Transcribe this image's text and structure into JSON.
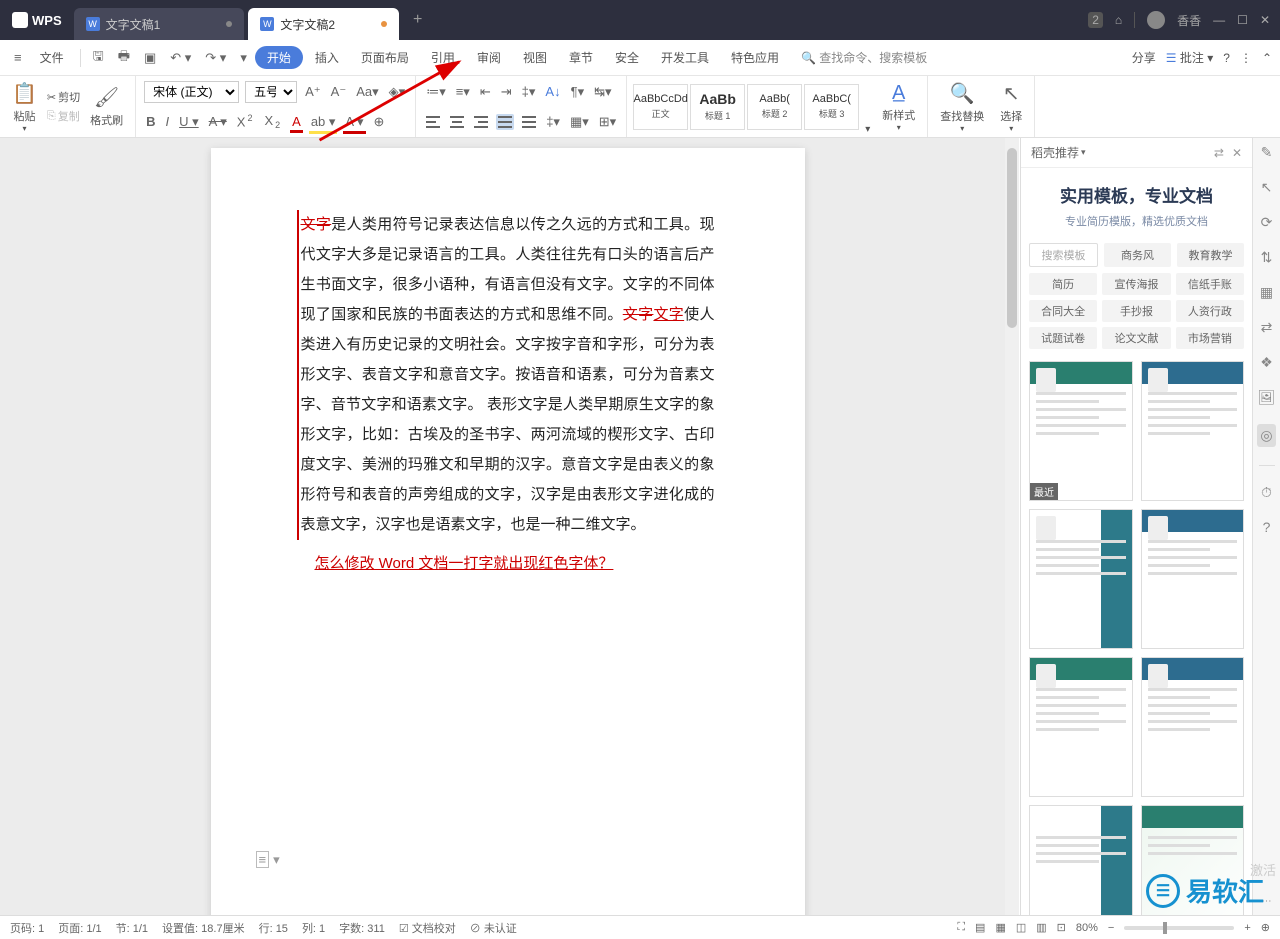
{
  "title_bar": {
    "logo": "WPS",
    "tabs": [
      {
        "label": "文字文稿1",
        "active": false
      },
      {
        "label": "文字文稿2",
        "active": true
      }
    ],
    "session_count": "2",
    "user": "香香"
  },
  "menu": {
    "file": "文件",
    "items": [
      "开始",
      "插入",
      "页面布局",
      "引用",
      "审阅",
      "视图",
      "章节",
      "安全",
      "开发工具",
      "特色应用"
    ],
    "search_placeholder": "查找命令、搜索模板",
    "share": "分享",
    "annotate": "批注"
  },
  "ribbon": {
    "paste": "粘贴",
    "cut": "剪切",
    "copy": "复制",
    "format_painter": "格式刷",
    "font_name": "宋体 (正文)",
    "font_size": "五号",
    "styles": [
      {
        "sample": "AaBbCcDd",
        "label": "正文"
      },
      {
        "sample": "AaBb",
        "label": "标题 1",
        "big": true
      },
      {
        "sample": "AaBb(",
        "label": "标题 2"
      },
      {
        "sample": "AaBbC(",
        "label": "标题 3"
      }
    ],
    "new_style": "新样式",
    "find_replace": "查找替换",
    "select": "选择"
  },
  "document": {
    "para1_a": "文字",
    "para1_b": "是人类用符号记录表达信息以传之久远的方式和工具。现代文字大多是记录语言的工具。人类往往先有口头的语言后产生书面文字，很多小语种，有语言但没有文字。文字的不同体现了国家和民族的书面表达的方式和思维不同。",
    "para1_c": "文字",
    "para1_d": "文字",
    "para1_e": "使人类进入有历史记录的文明社会。文字按字音和字形，可分为表形文字、表音文字和意音文字。按语音和语素，可分为音素文字、音节文字和语素文字。 表形文字是人类早期原生文字的象形文字，比如：古埃及的圣书字、两河流域的楔形文字、古印度文字、美洲的玛雅文和早期的汉字。意音文字是由表义的象形符号和表音的声旁组成的文字，汉字是由表形文字进化成的表意文字，汉字也是语素文字，也是一种二维文字。",
    "link": "怎么修改 Word 文档一打字就出现红色字体？"
  },
  "side": {
    "title": "稻壳推荐",
    "banner_t1": "实用模板，专业文档",
    "banner_t2": "专业简历模版，精选优质文档",
    "search_placeholder": "搜索模板",
    "tabs": [
      "商务风",
      "教育教学"
    ],
    "cats": [
      "简历",
      "宣传海报",
      "信纸手账",
      "合同大全",
      "手抄报",
      "人资行政",
      "试题试卷",
      "论文文献",
      "市场营销"
    ],
    "recent_badge": "最近"
  },
  "status": {
    "page_no": "页码: 1",
    "page": "页面: 1/1",
    "section": "节: 1/1",
    "setting": "设置值: 18.7厘米",
    "row": "行: 15",
    "col": "列: 1",
    "words": "字数: 311",
    "check": "文档校对",
    "auth": "未认证",
    "zoom": "80%",
    "activate": "激活"
  },
  "watermark": "易软汇"
}
